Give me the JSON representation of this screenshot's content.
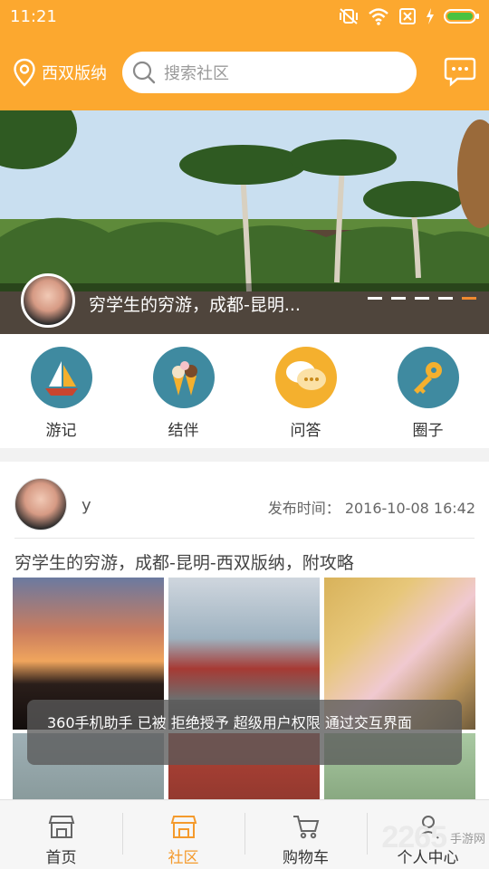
{
  "status_bar": {
    "time": "11:21"
  },
  "header": {
    "location": "西双版纳",
    "search_placeholder": "搜索社区",
    "colors": {
      "accent": "#fca82f"
    }
  },
  "banner": {
    "caption": "穷学生的穷游，成都-昆明...",
    "slide_count": 5,
    "active_slide": 5
  },
  "categories": [
    {
      "label": "游记",
      "icon": "sailboat-icon"
    },
    {
      "label": "结伴",
      "icon": "ice-cream-icon"
    },
    {
      "label": "问答",
      "icon": "speech-bubble-icon"
    },
    {
      "label": "圈子",
      "icon": "key-icon"
    }
  ],
  "post": {
    "username": "y",
    "published_label": "发布时间：",
    "published_time": "2016-10-08 16:42",
    "title": "穷学生的穷游，成都-昆明-西双版纳，附攻略"
  },
  "toast": "360手机助手 已被 拒绝授予 超级用户权限 通过交互界面",
  "bottom_nav": [
    {
      "label": "首页",
      "icon": "store-icon",
      "active": false
    },
    {
      "label": "社区",
      "icon": "store-icon",
      "active": true
    },
    {
      "label": "购物车",
      "icon": "cart-icon",
      "active": false
    },
    {
      "label": "个人中心",
      "icon": "person-icon",
      "active": false
    }
  ],
  "watermark": {
    "big": "2265",
    "small": "手游网"
  }
}
